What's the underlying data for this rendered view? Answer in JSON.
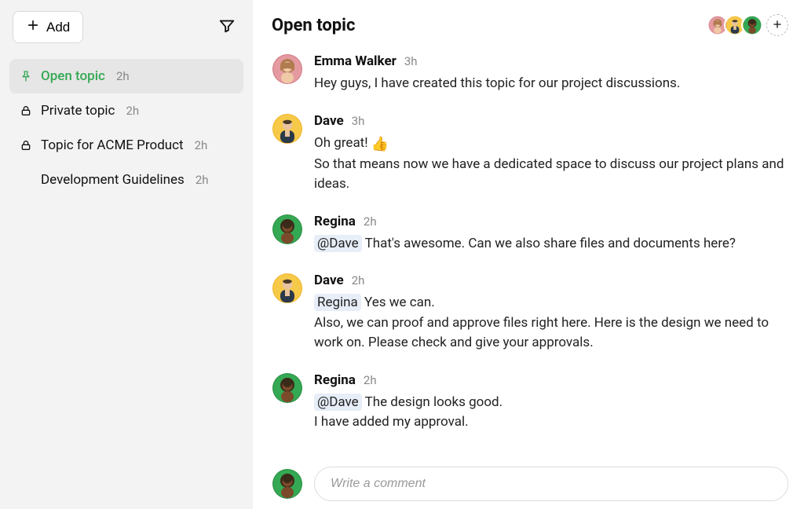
{
  "sidebar": {
    "add_label": "Add",
    "topics": [
      {
        "icon": "pin",
        "label": "Open topic",
        "time": "2h",
        "active": true
      },
      {
        "icon": "lock",
        "label": "Private topic",
        "time": "2h",
        "active": false
      },
      {
        "icon": "lock",
        "label": "Topic for ACME Product",
        "time": "2h",
        "active": false
      },
      {
        "icon": "",
        "label": "Development Guidelines",
        "time": "2h",
        "active": false
      }
    ]
  },
  "header": {
    "title": "Open topic",
    "participants": [
      "emma",
      "dave",
      "regina"
    ]
  },
  "messages": [
    {
      "author": "Emma Walker",
      "avatar": "emma",
      "time": "3h",
      "lines": [
        {
          "text": "Hey guys, I have created this topic for our project discussions."
        }
      ]
    },
    {
      "author": "Dave",
      "avatar": "dave",
      "time": "3h",
      "lines": [
        {
          "text": "Oh great! ",
          "emoji": "👍"
        },
        {
          "text": "So that means now we have a dedicated space to discuss our project plans and ideas."
        }
      ]
    },
    {
      "author": "Regina",
      "avatar": "regina",
      "time": "2h",
      "lines": [
        {
          "mention": "@Dave",
          "text": " That's awesome. Can we also share files and documents here?"
        }
      ]
    },
    {
      "author": "Dave",
      "avatar": "dave",
      "time": "2h",
      "lines": [
        {
          "mention": "Regina",
          "text": "  Yes we can."
        },
        {
          "text": "Also, we can proof and approve files right here. Here is the design we need to work on. Please check and give your approvals."
        }
      ]
    },
    {
      "author": "Regina",
      "avatar": "regina",
      "time": "2h",
      "lines": [
        {
          "mention": "@Dave",
          "text": "  The design looks good."
        },
        {
          "text": "I have added my approval."
        }
      ]
    }
  ],
  "compose": {
    "avatar": "regina",
    "placeholder": "Write a comment"
  },
  "avatar_colors": {
    "emma": {
      "bg": "#e49aa0",
      "ring": "#d07a85"
    },
    "dave": {
      "bg": "#f7c948",
      "ring": "#f0b429"
    },
    "regina": {
      "bg": "#34a853",
      "ring": "#2d8f46"
    }
  }
}
